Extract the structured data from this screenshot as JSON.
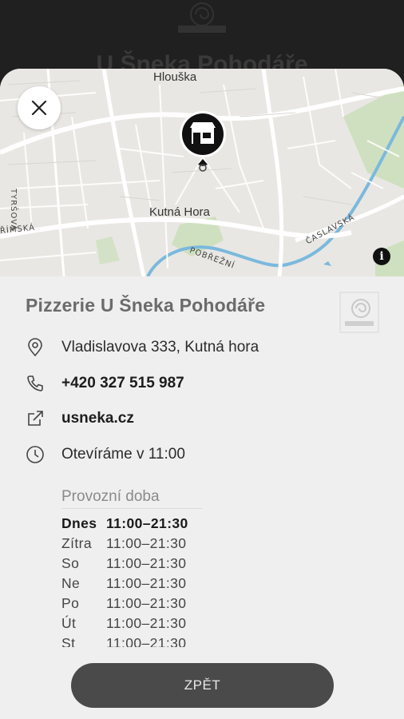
{
  "backdrop": {
    "title": "U Šneka Pohodáře"
  },
  "map": {
    "labels": {
      "north": "Hlouška",
      "center": "Kutná Hora"
    },
    "streets": {
      "tyrsova": "TYRŠOVA",
      "rimska": "ŘÍMSKÁ",
      "pobrezni": "POBŘEŽNÍ",
      "caslavska": "ČASLAVSKÁ"
    },
    "info_glyph": "i"
  },
  "place": {
    "title": "Pizzerie U Šneka Pohodáře",
    "address": "Vladislavova 333, Kutná hora",
    "phone": "+420 327 515 987",
    "website": "usneka.cz",
    "status": "Otevíráme v 11:00"
  },
  "hours": {
    "heading": "Provozní doba",
    "rows": [
      {
        "day": "Dnes",
        "time": "11:00–21:30"
      },
      {
        "day": "Zítra",
        "time": "11:00–21:30"
      },
      {
        "day": "So",
        "time": "11:00–21:30"
      },
      {
        "day": "Ne",
        "time": "11:00–21:30"
      },
      {
        "day": "Po",
        "time": "11:00–21:30"
      },
      {
        "day": "Út",
        "time": "11:00–21:30"
      },
      {
        "day": "St",
        "time": "11:00–21:30"
      }
    ]
  },
  "actions": {
    "back_label": "ZPĚT"
  },
  "colors": {
    "sheet": "#efefef",
    "button": "#4a4a4a",
    "backdrop": "#202020",
    "river": "#7ab9dd",
    "park": "#c9dcb8"
  }
}
